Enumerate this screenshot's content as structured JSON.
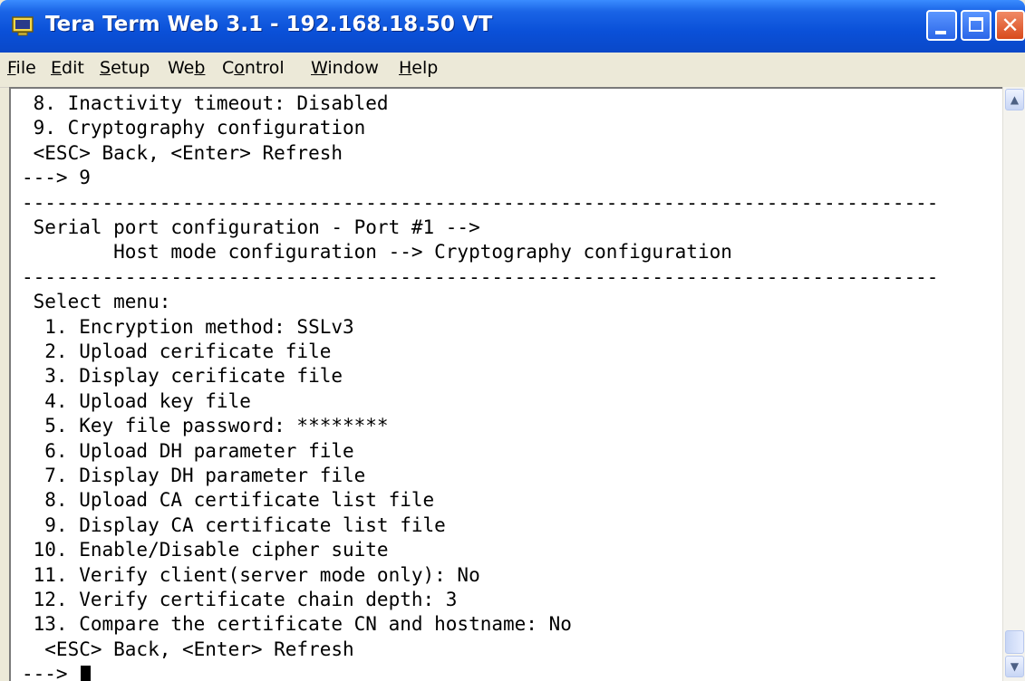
{
  "window": {
    "title": "Tera Term Web 3.1 - 192.168.18.50 VT",
    "icon": "terminal-icon"
  },
  "menu": [
    {
      "label": "File",
      "underline": "F",
      "rest": "ile"
    },
    {
      "label": "Edit",
      "underline": "E",
      "rest": "dit"
    },
    {
      "label": "Setup",
      "underline": "S",
      "rest": "etup"
    },
    {
      "label": "Web",
      "prefix": "We",
      "underline": "b",
      "rest": ""
    },
    {
      "label": "Control",
      "prefix": "C",
      "underline": "o",
      "rest": "ntrol"
    },
    {
      "label": "Window",
      "underline": "W",
      "rest": "indow"
    },
    {
      "label": "Help",
      "underline": "H",
      "rest": "elp"
    }
  ],
  "terminal": {
    "lines": [
      " 8. Inactivity timeout: Disabled",
      " 9. Cryptography configuration",
      " <ESC> Back, <Enter> Refresh",
      "---> 9",
      "--------------------------------------------------------------------------------",
      " Serial port configuration - Port #1 -->",
      "        Host mode configuration --> Cryptography configuration",
      "--------------------------------------------------------------------------------",
      " Select menu:",
      "  1. Encryption method: SSLv3",
      "  2. Upload cerificate file",
      "  3. Display cerificate file",
      "  4. Upload key file",
      "  5. Key file password: ********",
      "  6. Upload DH parameter file",
      "  7. Display DH parameter file",
      "  8. Upload CA certificate list file",
      "  9. Display CA certificate list file",
      " 10. Enable/Disable cipher suite",
      " 11. Verify client(server mode only): No",
      " 12. Verify certificate chain depth: 3",
      " 13. Compare the certificate CN and hostname: No",
      "  <ESC> Back, <Enter> Refresh",
      "---> "
    ]
  }
}
